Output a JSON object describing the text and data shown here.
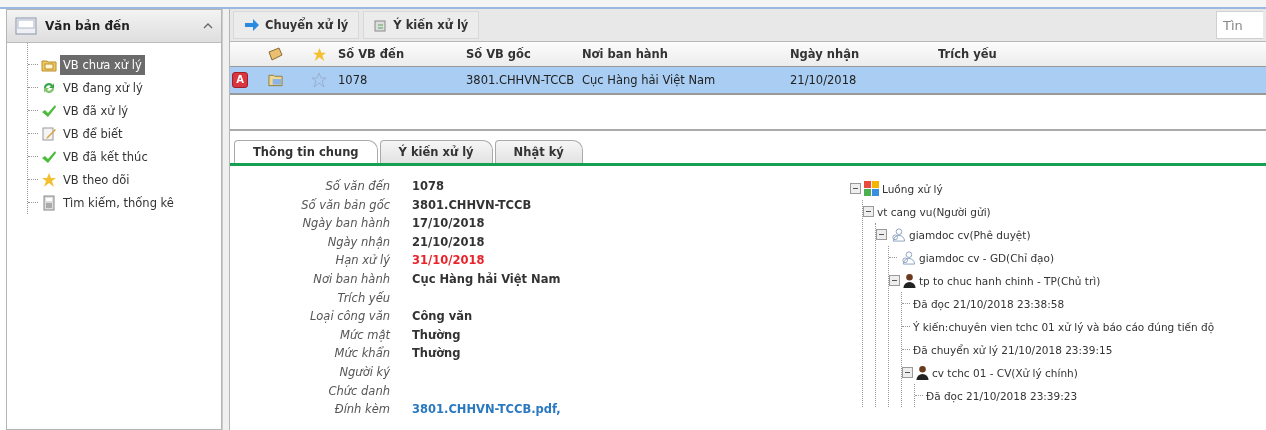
{
  "sidebar": {
    "title": "Văn bản đến",
    "expanded": true,
    "items": [
      {
        "label": "VB chưa xử lý",
        "kind": "folder",
        "selected": true
      },
      {
        "label": "VB đang xử lý",
        "kind": "refresh",
        "selected": false
      },
      {
        "label": "VB đã xử lý",
        "kind": "check",
        "selected": false
      },
      {
        "label": "VB để biết",
        "kind": "note",
        "selected": false
      },
      {
        "label": "VB đã kết thúc",
        "kind": "check",
        "selected": false
      },
      {
        "label": "VB theo dõi",
        "kind": "star",
        "selected": false
      },
      {
        "label": "Tìm kiếm, thống kê",
        "kind": "calculator",
        "selected": false
      }
    ]
  },
  "toolbar": {
    "buttons": [
      {
        "label": "Chuyển xử lý",
        "kind": "forward"
      },
      {
        "label": "Ý kiến xử lý",
        "kind": "comment"
      }
    ],
    "search": {
      "placeholder": "Tìn"
    }
  },
  "table": {
    "columns": [
      "Số VB đến",
      "Số VB gốc",
      "Nơi ban hành",
      "Ngày nhận",
      "Trích yếu"
    ],
    "rows": [
      {
        "badge": "A",
        "starred": false,
        "selected": true,
        "cells": [
          "1078",
          "3801.CHHVN-TCCB",
          "Cục Hàng hải Việt Nam",
          "21/10/2018",
          ""
        ]
      }
    ]
  },
  "tabs": [
    {
      "label": "Thông tin chung",
      "selected": true
    },
    {
      "label": "Ý kiến xử lý",
      "selected": false
    },
    {
      "label": "Nhật ký",
      "selected": false
    }
  ],
  "details": [
    {
      "label": "Số văn đến",
      "value": "1078",
      "kind": "text"
    },
    {
      "label": "Số văn bản gốc",
      "value": "3801.CHHVN-TCCB",
      "kind": "text"
    },
    {
      "label": "Ngày ban hành",
      "value": "17/10/2018",
      "kind": "text"
    },
    {
      "label": "Ngày nhận",
      "value": "21/10/2018",
      "kind": "text"
    },
    {
      "label": "Hạn xử lý",
      "value": "31/10/2018",
      "kind": "deadline"
    },
    {
      "label": "Nơi ban hành",
      "value": "Cục Hàng hải Việt Nam",
      "kind": "text"
    },
    {
      "label": "Trích yếu"
    },
    {
      "label": "Loại công văn",
      "value": "Công văn",
      "kind": "text"
    },
    {
      "label": "Mức mật",
      "value": "Thường",
      "kind": "text"
    },
    {
      "label": "Mức khẩn",
      "value": "Thường",
      "kind": "text"
    },
    {
      "label": "Người ký"
    },
    {
      "label": "Chức danh"
    },
    {
      "label": "Đính kèm",
      "value": "3801.CHHVN-TCCB.pdf,",
      "kind": "link"
    }
  ],
  "flow_tree": [
    {
      "label": "Luồng xử lý",
      "kind": "flow",
      "expanded": true,
      "children": [
        {
          "label": "vt cang vu(Người gửi)",
          "expanded": true,
          "children": [
            {
              "label": "giamdoc cv(Phê duyệt)",
              "kind": "group",
              "expanded": true,
              "children": [
                {
                  "label": "giamdoc cv - GD(Chỉ đạo)",
                  "kind": "group"
                },
                {
                  "label": "tp to chuc hanh chinh - TP(Chủ trì)",
                  "kind": "person",
                  "expanded": true,
                  "children": [
                    {
                      "label": "Đã đọc 21/10/2018 23:38:58"
                    },
                    {
                      "label": "Ý kiến:chuyên vien tchc 01 xử lý và báo cáo đúng tiến độ"
                    },
                    {
                      "label": "Đã chuyển xử lý 21/10/2018 23:39:15"
                    },
                    {
                      "label": "cv tchc 01 - CV(Xử lý chính)",
                      "kind": "person",
                      "expanded": true,
                      "children": [
                        {
                          "label": "Đã đọc 21/10/2018 23:39:23"
                        }
                      ]
                    }
                  ]
                }
              ]
            }
          ]
        }
      ]
    }
  ]
}
